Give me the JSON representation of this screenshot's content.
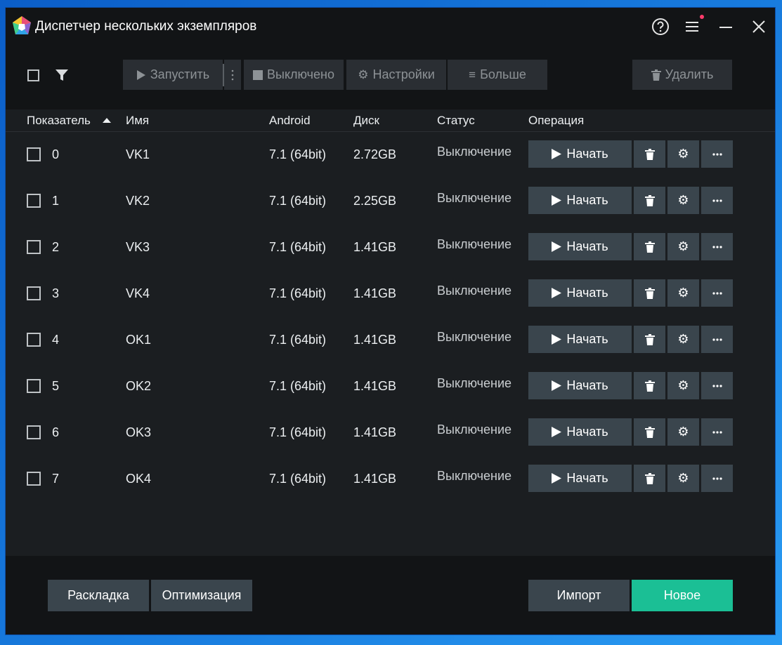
{
  "window": {
    "title": "Диспетчер нескольких экземпляров"
  },
  "toolbar": {
    "start_label": "Запустить",
    "off_label": "Выключено",
    "settings_label": "Настройки",
    "more_label": "Больше",
    "delete_label": "Удалить"
  },
  "columns": {
    "index": "Показатель",
    "name": "Имя",
    "android": "Android",
    "disk": "Диск",
    "status": "Статус",
    "operation": "Операция"
  },
  "rows": [
    {
      "index": "0",
      "name": "VK1",
      "android": "7.1 (64bit)",
      "disk": "2.72GB",
      "status": "Выключение",
      "start_label": "Начать"
    },
    {
      "index": "1",
      "name": "VK2",
      "android": "7.1 (64bit)",
      "disk": "2.25GB",
      "status": "Выключение",
      "start_label": "Начать"
    },
    {
      "index": "2",
      "name": "VK3",
      "android": "7.1 (64bit)",
      "disk": "1.41GB",
      "status": "Выключение",
      "start_label": "Начать"
    },
    {
      "index": "3",
      "name": "VK4",
      "android": "7.1 (64bit)",
      "disk": "1.41GB",
      "status": "Выключение",
      "start_label": "Начать"
    },
    {
      "index": "4",
      "name": "OK1",
      "android": "7.1 (64bit)",
      "disk": "1.41GB",
      "status": "Выключение",
      "start_label": "Начать"
    },
    {
      "index": "5",
      "name": "OK2",
      "android": "7.1 (64bit)",
      "disk": "1.41GB",
      "status": "Выключение",
      "start_label": "Начать"
    },
    {
      "index": "6",
      "name": "OK3",
      "android": "7.1 (64bit)",
      "disk": "1.41GB",
      "status": "Выключение",
      "start_label": "Начать"
    },
    {
      "index": "7",
      "name": "OK4",
      "android": "7.1 (64bit)",
      "disk": "1.41GB",
      "status": "Выключение",
      "start_label": "Начать"
    }
  ],
  "footer": {
    "layout_label": "Раскладка",
    "optimize_label": "Оптимизация",
    "import_label": "Импорт",
    "new_label": "Новое"
  },
  "colors": {
    "accent": "#1bbf95",
    "button_bg": "#3a454d",
    "window_bg": "#1b1e21",
    "notify_dot": "#ff3b6b"
  },
  "icons": [
    "app-logo-icon",
    "help-icon",
    "menu-icon",
    "minimize-icon",
    "close-icon",
    "filter-icon",
    "play-icon",
    "kebab-icon",
    "stop-icon",
    "gear-icon",
    "list-icon",
    "trash-icon",
    "more-dots-icon",
    "sort-up-icon"
  ]
}
